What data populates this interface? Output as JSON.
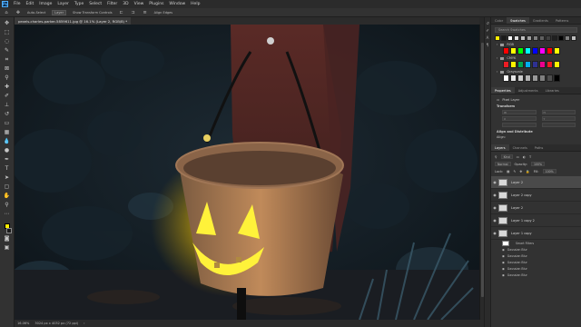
{
  "menubar": {
    "logo": "Ps",
    "items": [
      "File",
      "Edit",
      "Image",
      "Layer",
      "Type",
      "Select",
      "Filter",
      "3D",
      "View",
      "Plugins",
      "Window",
      "Help"
    ]
  },
  "options": {
    "auto_select_label": "Auto-Select",
    "auto_select_value": "Layer",
    "transform_label": "Show Transform Controls",
    "align_label": "Align Edges"
  },
  "document": {
    "tab_title": "pexels-charles-parker-5859611.jpg @ 16.1% (Layer 2, RGB/8) *"
  },
  "status": {
    "zoom": "16.06%",
    "size": "3024 px x 4032 px (72 ppi)"
  },
  "swatches_panel": {
    "tabs": [
      "Color",
      "Swatches",
      "Gradients",
      "Patterns"
    ],
    "active_tab": "Swatches",
    "search_placeholder": "Search Swatches",
    "recent_colors": [
      "#ffee00",
      "#1a1a1a",
      "#ffffff",
      "#e0e0e0",
      "#c0c0c0",
      "#a0a0a0",
      "#808080",
      "#606060",
      "#404040",
      "#202020",
      "#000000",
      "#7f7f7f",
      "#bfbfbf"
    ],
    "groups": [
      {
        "name": "RGB",
        "colors": [
          "#ff0000",
          "#ffff00",
          "#00ff00",
          "#00ffff",
          "#0000ff",
          "#ff00ff",
          "#ff0000",
          "#ffff00"
        ]
      },
      {
        "name": "CMYK",
        "colors": [
          "#ed1c24",
          "#fff200",
          "#00a651",
          "#00aeef",
          "#2e3192",
          "#ec008c",
          "#ed1c24",
          "#fff200"
        ]
      },
      {
        "name": "Grayscale",
        "colors": [
          "#ffffff",
          "#e6e6e6",
          "#cccccc",
          "#b3b3b3",
          "#999999",
          "#808080",
          "#4d4d4d",
          "#000000"
        ]
      }
    ]
  },
  "properties_panel": {
    "tabs": [
      "Properties",
      "Adjustments",
      "Libraries"
    ],
    "active_tab": "Properties",
    "layer_type": "Pixel Layer",
    "transform_label": "Transform",
    "transform_fields": [
      "W",
      "H",
      "X",
      "Y",
      "",
      ""
    ],
    "align_label": "Align and Distribute",
    "align_sub": "Align:"
  },
  "layers_panel": {
    "tabs": [
      "Layers",
      "Channels",
      "Paths"
    ],
    "active_tab": "Layers",
    "kind_label": "Kind",
    "blend_mode": "Normal",
    "opacity_label": "Opacity:",
    "opacity_value": "100%",
    "lock_label": "Lock:",
    "fill_label": "Fill:",
    "fill_value": "100%",
    "layers": [
      {
        "name": "Layer 2",
        "selected": true
      },
      {
        "name": "Layer 2 copy",
        "selected": false
      },
      {
        "name": "Layer 2",
        "selected": false
      },
      {
        "name": "Layer 1 copy 2",
        "selected": false
      },
      {
        "name": "Layer 1 copy",
        "selected": false
      }
    ],
    "smart_filters_label": "Smart Filters",
    "filters": [
      "Gaussian Blur",
      "Gaussian Blur",
      "Gaussian Blur",
      "Gaussian Blur",
      "Gaussian Blur"
    ]
  }
}
